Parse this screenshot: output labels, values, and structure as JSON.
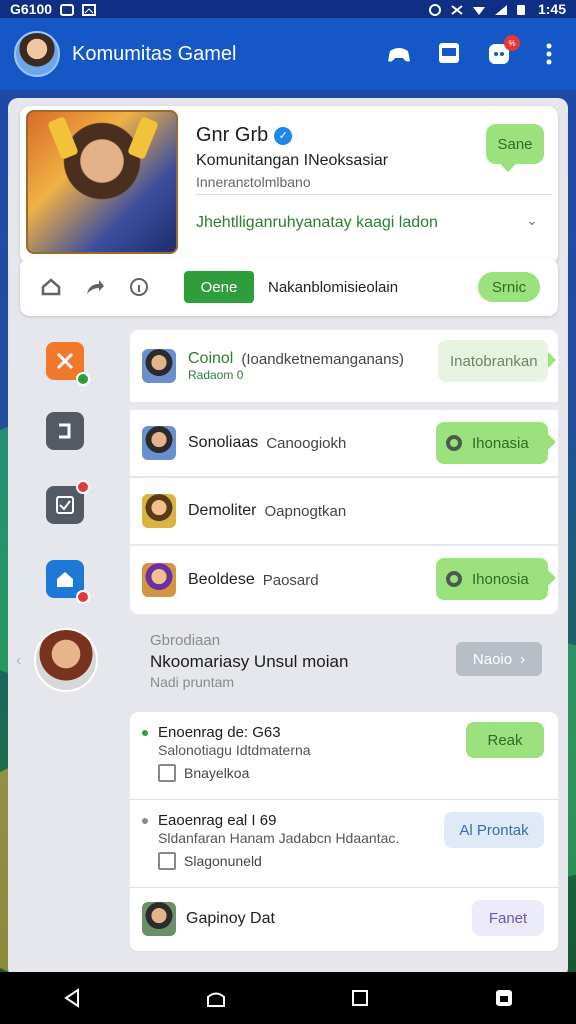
{
  "status_bar": {
    "left_text": "G6100",
    "time": "1:45"
  },
  "app": {
    "title": "Komumitas Gamel",
    "notification_count": "%"
  },
  "profile": {
    "name": "Gnr Grb",
    "subtitle": "Komunitangan INeoksasiar",
    "meta": "Inneranɛtolmlbano",
    "tagline": "Jhehtlliganruhyanatay kaagi ladon",
    "share_label": "Sane"
  },
  "action_bar": {
    "open_label": "Oene",
    "action_text": "Nakanblomisieolain",
    "secondary_label": "Srnic"
  },
  "friends": [
    {
      "name": "Coinol",
      "status": "(Ioandketnemanganans)",
      "sub": "Radaom 0",
      "chip": "Inatobrankan"
    },
    {
      "name": "Sonoliaas",
      "status": "Canoogiokh",
      "chip": "Ihonasia"
    },
    {
      "name": "Demoliter",
      "status": "Oapnogtkan",
      "chip": ""
    },
    {
      "name": "Beoldese",
      "status": "Paosard",
      "chip": "Ihonosia"
    }
  ],
  "featured": {
    "line1": "Gbrodiaan",
    "line2": "Nkoomariasy Unsul moian",
    "line3": "Nadi pruntam",
    "button": "Naoio"
  },
  "events": [
    {
      "title": "Enoenrag de: G63",
      "desc": "Salonotiagu Idtdmaterna",
      "foot": "Bnayelkoa",
      "chip": "Reak",
      "chip_style": "green"
    },
    {
      "title": "Eaoenrag eal I 69",
      "desc": "Sldanfaran Hanam Jadabcn Hdaantac.",
      "foot": "Slagonuneld",
      "chip": "Al Prontak",
      "chip_style": "blue"
    },
    {
      "title": "Gapinoy Dat",
      "desc": "",
      "foot": "",
      "chip": "Fanet",
      "chip_style": "purple"
    }
  ],
  "colors": {
    "appbar": "#1557c6",
    "accent_green": "#2e9e3a",
    "chip_green": "#9be27f",
    "chip_text": "#2d6a25"
  }
}
